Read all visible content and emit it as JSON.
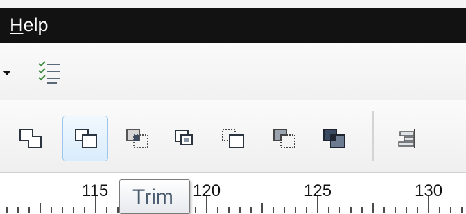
{
  "menu": {
    "help_mnemonic": "H",
    "help_rest": "elp"
  },
  "toolbar_top": {
    "icons": [
      "dropdown-arrow-icon",
      "checklist-icon"
    ]
  },
  "shaping_toolbar": {
    "buttons": [
      {
        "icon": "weld-icon"
      },
      {
        "icon": "trim-icon",
        "state": "hovered"
      },
      {
        "icon": "intersect-icon"
      },
      {
        "icon": "simplify-icon"
      },
      {
        "icon": "front-minus-back-icon"
      },
      {
        "icon": "back-minus-front-icon"
      },
      {
        "icon": "create-boundary-icon"
      },
      {
        "icon": "align-distribute-icon"
      }
    ]
  },
  "ruler": {
    "labels": [
      "115",
      "120",
      "125",
      "130"
    ]
  },
  "tooltip": {
    "text": "Trim"
  },
  "colors": {
    "menubar": "#121212",
    "hover_fill": "#d9ecfb",
    "hover_border": "#9cc6ec",
    "icon_dark": "#3a4a60"
  }
}
